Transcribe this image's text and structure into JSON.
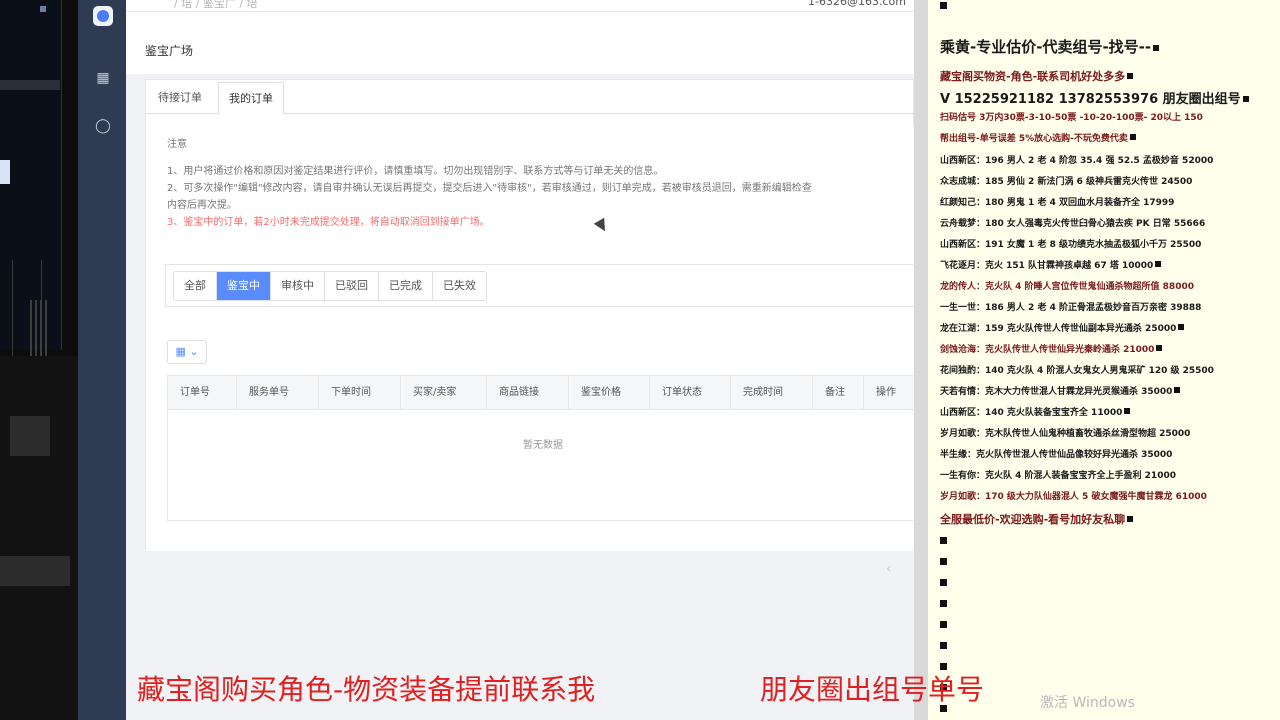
{
  "nav": {
    "items": [
      "building-icon",
      "user-icon"
    ]
  },
  "topbar": {
    "breadcrumb": "/ 培 / 鉴宝广 / 培",
    "user": "1-6326@163.com"
  },
  "page_title": "鉴宝广场",
  "tabs": [
    {
      "label": "待接订单"
    },
    {
      "label": "我的订单"
    }
  ],
  "notice": {
    "heading": "注意",
    "line1": "1、用户将通过价格和原因对鉴定结果进行评价，请慎重填写。切勿出现错别字、联系方式等与订单无关的信息。",
    "line2": "2、可多次操作\"编辑\"修改内容，请自审并确认无误后再提交，提交后进入\"待审核\"，若审核通过，则订单完成，若被审核员退回，需重新编辑检查",
    "line2b": "内容后再次提。",
    "line3": "3、鉴宝中的订单，若2小时未完成提交处理，将自动取消回到接单广场。"
  },
  "filters": [
    "全部",
    "鉴宝中",
    "审核中",
    "已驳回",
    "已完成",
    "已失效"
  ],
  "filter_active": "鉴宝中",
  "table": {
    "columns": [
      "订单号",
      "服务单号",
      "下单时间",
      "买家/卖家",
      "商品链接",
      "鉴宝价格",
      "订单状态",
      "完成时间",
      "备注",
      "操作"
    ],
    "empty": "暂无数据"
  },
  "info": {
    "lines": [
      "乘黄-专业估价-代卖组号-找号--",
      "藏宝阁买物资-角色-联系司机好处多多",
      "V 15225921182  13782553976 朋友圈出组号",
      "扫码估号 3万内30票-3-10-50票 -10-20-100票- 20以上 150",
      "帮出组号-单号误差 5%放心选购-不玩免费代卖",
      "山西新区：196 男人 2 老 4 阶忽 35.4 强 52.5 孟极妙音 52000",
      "众志成城：185 男仙 2 新法门涡 6 级神兵雷克火传世 24500",
      "红颜知己：180 男鬼 1 老 4 双回血水月装备齐全 17999",
      "云舟载梦：180 女人强毒克火传世臼骨心猿去疾 PK 日常 55666",
      "山西新区：191 女魔 1 老 8 级功绩克水抽孟极狐小千万 25500",
      "飞花逐月：克火 151 队甘霖神孩卓越 67 塔 10000",
      "龙的传人：克火队 4 阶睡人宫位传世鬼仙通杀物超所值 88000",
      "一生一世：186 男人 2 老 4 阶正骨混孟极妙音百万亲密 39888",
      "龙在江湖：159 克火队传世人传世仙副本异光通杀 25000",
      "剑蚀沧海：克火队传世人传世仙异光秦岭通杀 21000",
      "花间独酌：140 克火队 4 阶混人女鬼女人男鬼采矿 120 级 25500",
      "天若有情：克木大力传世混人甘霖龙异光灵猴通杀 35000",
      "山西新区：140 克火队装备宝宝齐全 11000",
      "岁月如歌：克木队传世人仙鬼种植畜牧通杀丝滑型物超 25000",
      "半生缘：克火队传世混人传世仙品像较好异光通杀 35000",
      "一生有你：克火队 4 阶混人装备宝宝齐全上手盈利 21000",
      "岁月如歌：170 级大力队仙器混人 5 破女魔强牛魔甘霖龙 61000",
      "全服最低价-欢迎选购-看号加好友私聊"
    ]
  },
  "overlay": {
    "bottom_left": "藏宝阁购买角色-物资装备提前联系我",
    "bottom_right": "朋友圈出组号单号",
    "watermark": "激活 Windows"
  }
}
